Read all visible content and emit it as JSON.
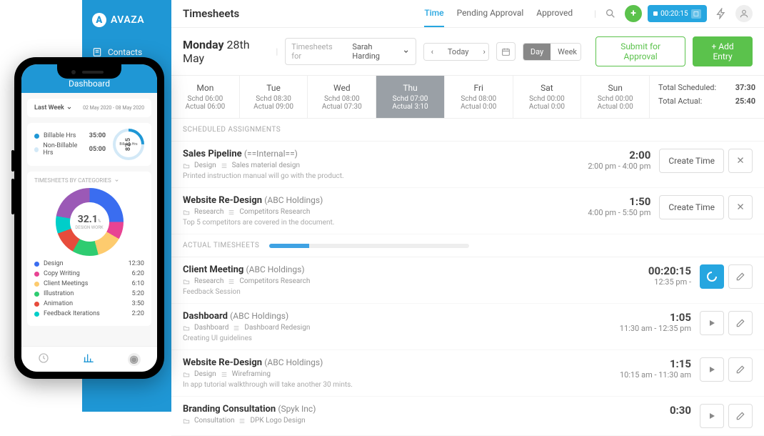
{
  "brand": "AVAZA",
  "sidebar_nav": {
    "contacts": "Contacts"
  },
  "header": {
    "title": "Timesheets",
    "tabs": {
      "time": "Time",
      "pending": "Pending Approval",
      "approved": "Approved"
    },
    "timer_pill": "00:20:15"
  },
  "controls": {
    "day_label": "Monday",
    "date_label": "28th May",
    "timesheets_for_label": "Timesheets for",
    "user": "Sarah Harding",
    "today": "Today",
    "day": "Day",
    "week": "Week",
    "submit": "Submit for Approval",
    "add": "+  Add Entry"
  },
  "week": [
    {
      "name": "Mon",
      "schd": "Schd   06:00",
      "actual": "Actual   06:00"
    },
    {
      "name": "Tue",
      "schd": "Schd   08:30",
      "actual": "Actual   09:00"
    },
    {
      "name": "Wed",
      "schd": "Schd   08:00",
      "actual": "Actual   07:30"
    },
    {
      "name": "Thu",
      "schd": "Schd   07:00",
      "actual": "Actual   3:10"
    },
    {
      "name": "Fri",
      "schd": "Schd   08:00",
      "actual": "Actual   0:00"
    },
    {
      "name": "Sat",
      "schd": "Schd   00:00",
      "actual": "Actual   0:00"
    },
    {
      "name": "Sun",
      "schd": "Schd   00:00",
      "actual": "Actual   0:00"
    }
  ],
  "totals": {
    "schd_label": "Total Scheduled:",
    "schd": "37:30",
    "act_label": "Total Actual:",
    "act": "25:40"
  },
  "sect": {
    "scheduled": "SCHEDULED ASSIGNMENTS",
    "actual": "ACTUAL TIMESHEETS"
  },
  "actions": {
    "create_time": "Create Time"
  },
  "scheduled": [
    {
      "proj": "Sales Pipeline",
      "client": "(==Internal==)",
      "cat": "Design",
      "task": "Sales material design",
      "desc": "Printed instruction manual will go with the product.",
      "dur": "2:00",
      "range": "2:00 pm - 4:00 pm"
    },
    {
      "proj": "Website Re-Design",
      "client": "(ABC Holdings)",
      "cat": "Research",
      "task": "Competitors Research",
      "desc": "Top 5 competitors are covered in the document.",
      "dur": "1:50",
      "range": "4:00 pm - 5:50 pm"
    }
  ],
  "actual": [
    {
      "proj": "Client Meeting",
      "client": "(ABC Holdings)",
      "cat": "Research",
      "task": "Competitors Research",
      "desc": "Feedback Session",
      "dur": "00:20:15",
      "range": "12:35 pm -",
      "running": true
    },
    {
      "proj": "Dashboard",
      "client": "(ABC Holdings)",
      "cat": "Dashboard",
      "task": "Dashboard Redesign",
      "desc": "Creating UI guidelines",
      "dur": "1:05",
      "range": "11:30 am - 12:35 pm"
    },
    {
      "proj": "Website Re-Design",
      "client": "(ABC Holdings)",
      "cat": "Design",
      "task": "Wireframing",
      "desc": "In app tutorial walkthrough will take another 30 mints.",
      "dur": "1:15",
      "range": "10:15 am - 11:30 am"
    },
    {
      "proj": "Branding Consultation",
      "client": "(Spyk Inc)",
      "cat": "Consultation",
      "task": "DPK Logo Design",
      "desc": "",
      "dur": "0:30",
      "range": ""
    }
  ],
  "phone": {
    "header": "Dashboard",
    "filter_label": "Last Week",
    "range": "02 May 2020 - 08 May 2020",
    "billable": {
      "label": "Billable Hrs",
      "val": "35:00"
    },
    "nonbillable": {
      "label": "Non-Billable Hrs",
      "val": "05:00"
    },
    "ring": "87.5",
    "ring_unit": "%",
    "ring_caption": "Billable Hrs",
    "cat_title": "TIMESHEETS BY CATEGORIES",
    "donut_val": "32.1",
    "donut_unit": "%",
    "donut_caption": "DESIGN WORK",
    "cats": [
      {
        "color": "#3a6df0",
        "name": "Design",
        "val": "12:30"
      },
      {
        "color": "#e84393",
        "name": "Copy Writing",
        "val": "6:20"
      },
      {
        "color": "#fdcb6e",
        "name": "Client Meetings",
        "val": "6:10"
      },
      {
        "color": "#2ecc71",
        "name": "Illustration",
        "val": "5:20"
      },
      {
        "color": "#e74c3c",
        "name": "Animation",
        "val": "3:50"
      },
      {
        "color": "#00cec9",
        "name": "Feedback Iterations",
        "val": "2:20"
      }
    ]
  }
}
